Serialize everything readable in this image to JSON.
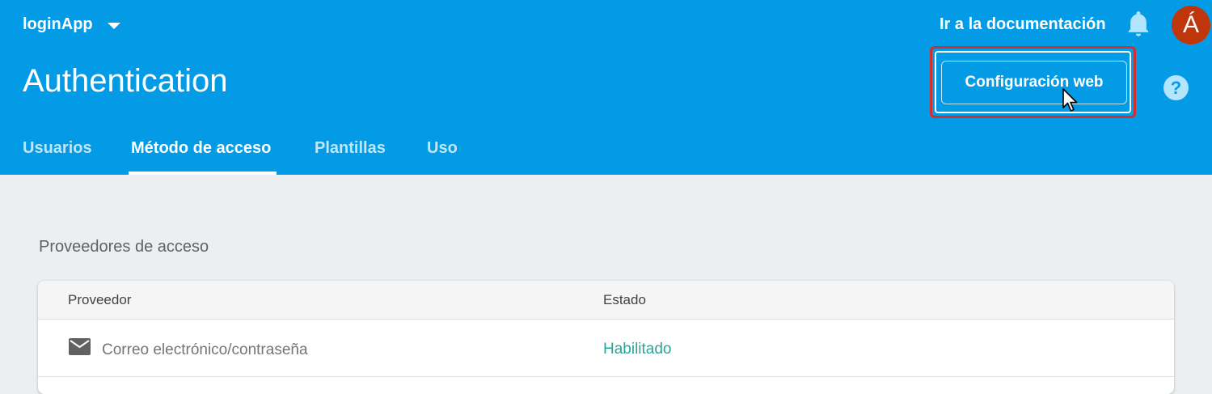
{
  "header": {
    "project_name": "loginApp",
    "docs_link": "Ir a la documentación",
    "avatar_initial": "Á",
    "page_title": "Authentication",
    "web_config_button": "Configuración web",
    "help_icon_label": "?"
  },
  "tabs": [
    {
      "label": "Usuarios",
      "active": false
    },
    {
      "label": "Método de acceso",
      "active": true
    },
    {
      "label": "Plantillas",
      "active": false
    },
    {
      "label": "Uso",
      "active": false
    }
  ],
  "section": {
    "title": "Proveedores de acceso"
  },
  "table": {
    "columns": [
      "Proveedor",
      "Estado"
    ],
    "rows": [
      {
        "icon": "mail-icon",
        "provider": "Correo electrónico/contraseña",
        "status": "Habilitado"
      }
    ]
  },
  "colors": {
    "header_bg": "#039be5",
    "page_bg": "#eceff1",
    "avatar_bg": "#bf360c",
    "highlight": "#d32f2f",
    "enabled_status": "#26a69a"
  }
}
